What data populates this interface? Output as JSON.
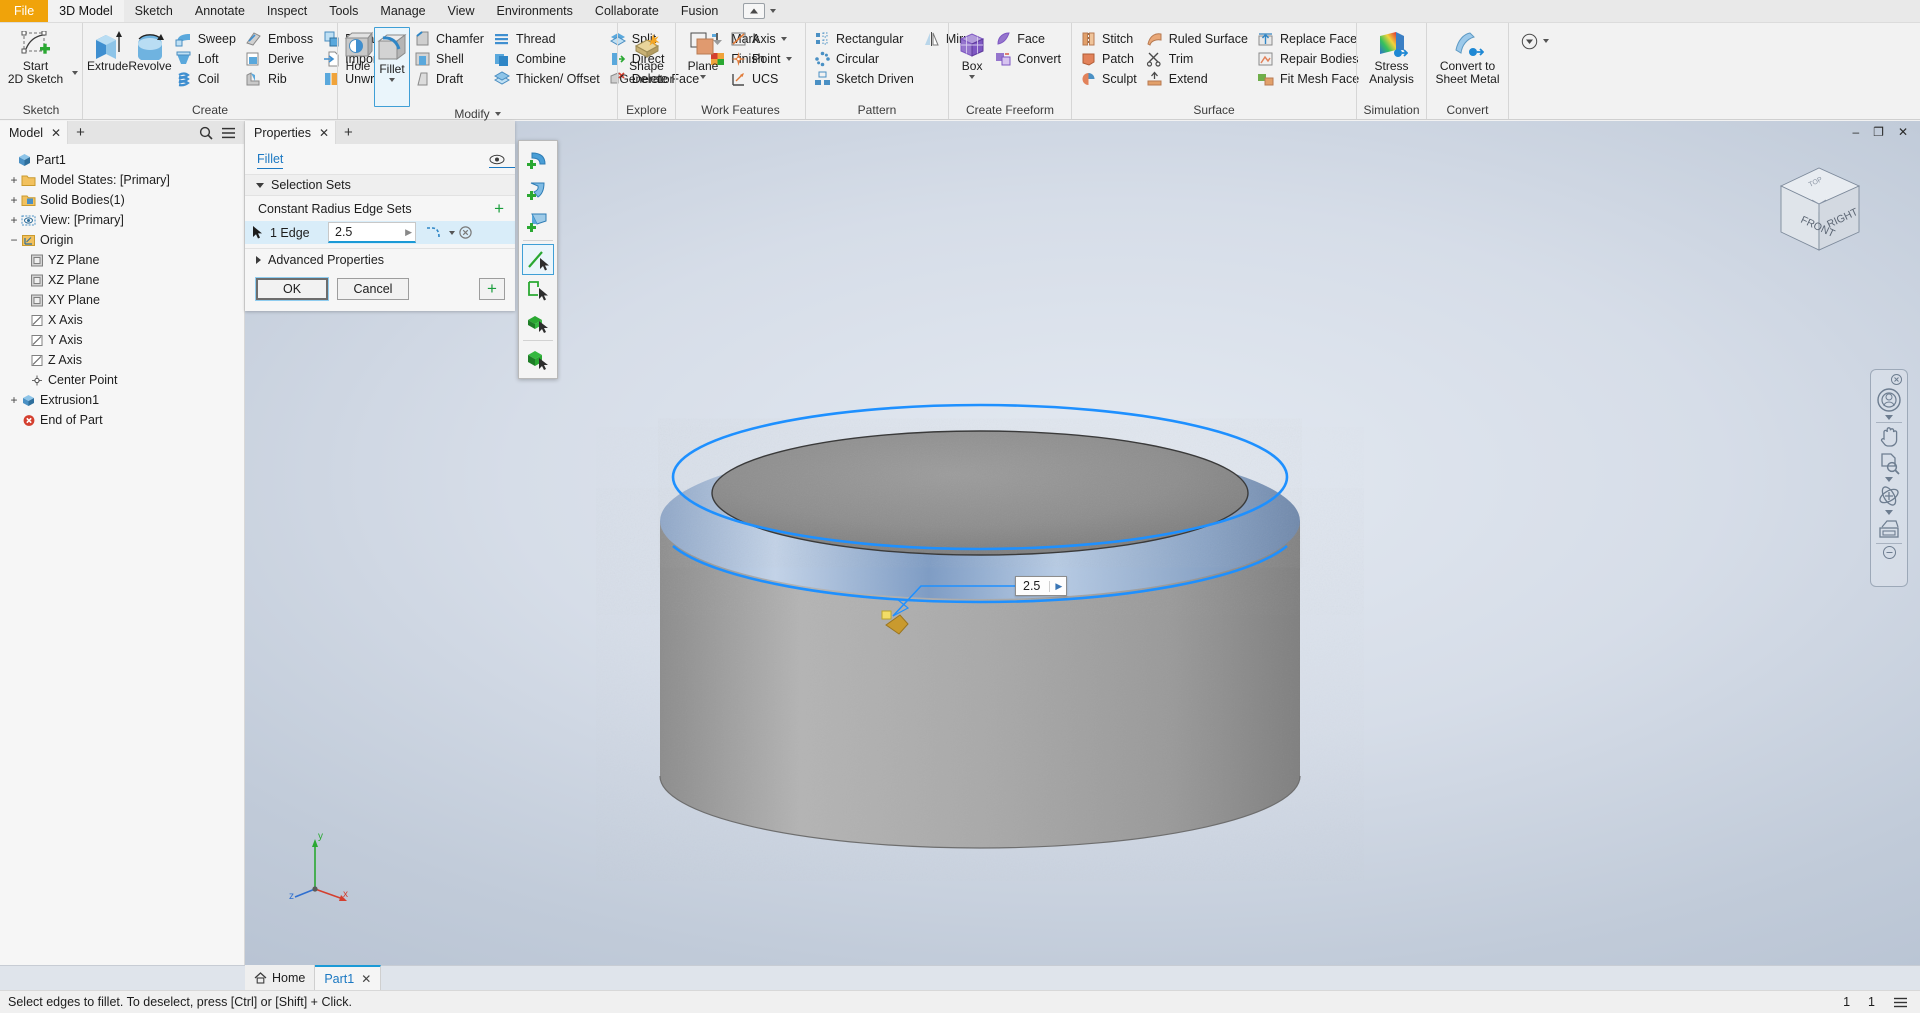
{
  "menu": {
    "items": [
      {
        "label": "File",
        "style": "file"
      },
      {
        "label": "3D Model",
        "style": "active"
      },
      {
        "label": "Sketch",
        "style": ""
      },
      {
        "label": "Annotate",
        "style": ""
      },
      {
        "label": "Inspect",
        "style": ""
      },
      {
        "label": "Tools",
        "style": ""
      },
      {
        "label": "Manage",
        "style": ""
      },
      {
        "label": "View",
        "style": ""
      },
      {
        "label": "Environments",
        "style": ""
      },
      {
        "label": "Collaborate",
        "style": ""
      },
      {
        "label": "Fusion",
        "style": ""
      }
    ],
    "quick_access_icon": "dropdown-button-icon"
  },
  "ribbon": {
    "panels": [
      {
        "title": "Sketch",
        "big": [
          {
            "label": "Start\n2D Sketch",
            "icon": "start-2d-sketch-icon",
            "dropdown": true
          }
        ],
        "cols": []
      },
      {
        "title": "Create",
        "big": [
          {
            "label": "Extrude",
            "icon": "extrude-icon"
          },
          {
            "label": "Revolve",
            "icon": "revolve-icon"
          }
        ],
        "cols": [
          [
            {
              "label": "Sweep",
              "icon": "sweep-icon"
            },
            {
              "label": "Loft",
              "icon": "loft-icon"
            },
            {
              "label": "Coil",
              "icon": "coil-icon"
            }
          ],
          [
            {
              "label": "Emboss",
              "icon": "emboss-icon"
            },
            {
              "label": "Derive",
              "icon": "derive-icon"
            },
            {
              "label": "Rib",
              "icon": "rib-icon"
            }
          ],
          [
            {
              "label": "Decal",
              "icon": "decal-icon"
            },
            {
              "label": "Import",
              "icon": "import-icon"
            },
            {
              "label": "Unwrap",
              "icon": "unwrap-icon"
            }
          ]
        ]
      },
      {
        "title": "Modify",
        "title_dropdown": true,
        "big": [
          {
            "label": "Hole",
            "icon": "hole-icon"
          },
          {
            "label": "Fillet",
            "icon": "fillet-icon",
            "dropdown": true,
            "selected": true
          }
        ],
        "cols": [
          [
            {
              "label": "Chamfer",
              "icon": "chamfer-icon"
            },
            {
              "label": "Shell",
              "icon": "shell-icon"
            },
            {
              "label": "Draft",
              "icon": "draft-icon"
            }
          ],
          [
            {
              "label": "Thread",
              "icon": "thread-icon"
            },
            {
              "label": "Combine",
              "icon": "combine-icon"
            },
            {
              "label": "Thicken/ Offset",
              "icon": "thicken-offset-icon"
            }
          ],
          [
            {
              "label": "Split",
              "icon": "split-icon"
            },
            {
              "label": "Direct",
              "icon": "direct-icon"
            },
            {
              "label": "Delete Face",
              "icon": "delete-face-icon"
            }
          ],
          [
            {
              "label": "Mark",
              "icon": "mark-icon"
            },
            {
              "label": "Finish",
              "icon": "finish-icon"
            }
          ]
        ]
      },
      {
        "title": "Explore",
        "big": [
          {
            "label": "Shape\nGenerator",
            "icon": "shape-generator-icon"
          }
        ],
        "cols": []
      },
      {
        "title": "Work Features",
        "big": [
          {
            "label": "Plane",
            "icon": "plane-icon",
            "dropdown": true
          }
        ],
        "cols": [
          [
            {
              "label": "Axis",
              "icon": "axis-icon",
              "dropdown": true
            },
            {
              "label": "Point",
              "icon": "point-icon",
              "dropdown": true
            },
            {
              "label": "UCS",
              "icon": "ucs-icon"
            }
          ]
        ]
      },
      {
        "title": "Pattern",
        "big": [],
        "cols": [
          [
            {
              "label": "Rectangular",
              "icon": "rectangular-pattern-icon"
            },
            {
              "label": "Circular",
              "icon": "circular-pattern-icon"
            },
            {
              "label": "Sketch Driven",
              "icon": "sketch-driven-pattern-icon"
            }
          ],
          [
            {
              "label": "Mirror",
              "icon": "mirror-icon"
            }
          ]
        ]
      },
      {
        "title": "Create Freeform",
        "big": [
          {
            "label": "Box",
            "icon": "box-icon",
            "dropdown": true
          }
        ],
        "cols": [
          [
            {
              "label": "Face",
              "icon": "face-icon"
            },
            {
              "label": "Convert",
              "icon": "convert-freeform-icon"
            }
          ]
        ]
      },
      {
        "title": "Surface",
        "big": [],
        "cols": [
          [
            {
              "label": "Stitch",
              "icon": "stitch-icon"
            },
            {
              "label": "Patch",
              "icon": "patch-icon"
            },
            {
              "label": "Sculpt",
              "icon": "sculpt-icon"
            }
          ],
          [
            {
              "label": "Ruled Surface",
              "icon": "ruled-surface-icon"
            },
            {
              "label": "Trim",
              "icon": "trim-icon"
            },
            {
              "label": "Extend",
              "icon": "extend-icon"
            }
          ],
          [
            {
              "label": "Replace Face",
              "icon": "replace-face-icon"
            },
            {
              "label": "Repair Bodies",
              "icon": "repair-bodies-icon"
            },
            {
              "label": "Fit Mesh Face",
              "icon": "fit-mesh-face-icon"
            }
          ]
        ]
      },
      {
        "title": "Simulation",
        "big": [
          {
            "label": "Stress\nAnalysis",
            "icon": "stress-analysis-icon"
          }
        ],
        "cols": []
      },
      {
        "title": "Convert",
        "big": [
          {
            "label": "Convert to\nSheet Metal",
            "icon": "convert-sheet-metal-icon"
          }
        ],
        "cols": []
      }
    ],
    "overflow_icon": "ribbon-overflow-icon"
  },
  "browser": {
    "tab_label": "Model",
    "close_icon": "close-icon",
    "add_icon": "add-tab-icon",
    "search_icon": "search-icon",
    "menu_icon": "hamburger-menu-icon",
    "nodes": [
      {
        "label": "Part1",
        "indent": 0,
        "expander": "",
        "icon": "part-icon"
      },
      {
        "label": "Model States: [Primary]",
        "indent": 1,
        "expander": "+",
        "icon": "folder-icon"
      },
      {
        "label": "Solid Bodies(1)",
        "indent": 1,
        "expander": "+",
        "icon": "solid-bodies-icon"
      },
      {
        "label": "View: [Primary]",
        "indent": 1,
        "expander": "+",
        "icon": "view-icon"
      },
      {
        "label": "Origin",
        "indent": 1,
        "expander": "-",
        "icon": "origin-icon"
      },
      {
        "label": "YZ Plane",
        "indent": 2,
        "expander": "",
        "icon": "plane-node-icon"
      },
      {
        "label": "XZ Plane",
        "indent": 2,
        "expander": "",
        "icon": "plane-node-icon"
      },
      {
        "label": "XY Plane",
        "indent": 2,
        "expander": "",
        "icon": "plane-node-icon"
      },
      {
        "label": "X Axis",
        "indent": 2,
        "expander": "",
        "icon": "axis-node-icon"
      },
      {
        "label": "Y Axis",
        "indent": 2,
        "expander": "",
        "icon": "axis-node-icon"
      },
      {
        "label": "Z Axis",
        "indent": 2,
        "expander": "",
        "icon": "axis-node-icon"
      },
      {
        "label": "Center Point",
        "indent": 2,
        "expander": "",
        "icon": "center-point-icon"
      },
      {
        "label": "Extrusion1",
        "indent": 1,
        "expander": "+",
        "icon": "extrusion-icon"
      },
      {
        "label": "End of Part",
        "indent": 1,
        "expander": "",
        "icon": "end-of-part-icon"
      }
    ]
  },
  "properties": {
    "tab_label": "Properties",
    "close_icon": "close-icon",
    "add_icon": "add-tab-icon",
    "command_name": "Fillet",
    "visibility_icon": "eye-icon",
    "section_selection_sets": "Selection Sets",
    "sub_label": "Constant Radius Edge Sets",
    "add_set_icon": "add-selection-set-icon",
    "edge_count_label": "1 Edge",
    "cursor_icon": "selection-arrow-icon",
    "radius_value": "2.5",
    "spinner_icon": "spinner-arrow-icon",
    "fillet_preview_icon": "fillet-radius-icon",
    "clear_icon": "clear-selection-icon",
    "section_advanced": "Advanced Properties",
    "ok_label": "OK",
    "cancel_label": "Cancel",
    "add_label": "+"
  },
  "mini_toolbar": {
    "buttons": [
      {
        "name": "add-constant-radius-fillet-icon"
      },
      {
        "name": "add-variable-radius-fillet-icon"
      },
      {
        "name": "add-setback-fillet-icon"
      },
      {
        "name": "select-edge-mode-icon",
        "selected": true
      },
      {
        "name": "select-loop-mode-icon"
      },
      {
        "name": "select-feature-mode-icon"
      },
      {
        "name": "select-solid-mode-icon"
      }
    ]
  },
  "viewport": {
    "dimension_callout": {
      "value": "2.5",
      "expand_icon": "callout-expand-icon"
    },
    "viewcube": {
      "face_front": "FRONT",
      "face_right": "RIGHT",
      "face_top": "TOP",
      "name": "view-cube"
    },
    "navbar": {
      "buttons": [
        {
          "name": "full-navigation-wheel-icon"
        },
        {
          "name": "pan-icon"
        },
        {
          "name": "zoom-icon"
        },
        {
          "name": "orbit-icon"
        },
        {
          "name": "look-at-icon"
        },
        {
          "name": "navbar-options-icon"
        }
      ],
      "close_icon": "navbar-close-icon"
    },
    "triad": {
      "x_label": "x",
      "y_label": "y",
      "z_label": "z"
    }
  },
  "window_controls": {
    "minimize": "–",
    "restore": "❐",
    "close": "✕"
  },
  "doc_tabs": {
    "home_label": "Home",
    "home_icon": "home-icon",
    "tabs": [
      {
        "label": "Part1",
        "active": true,
        "close_icon": "close-icon"
      }
    ]
  },
  "status_bar": {
    "message": "Select edges to fillet. To deselect, press [Ctrl] or [Shift] + Click.",
    "page_current": "1",
    "page_total": "1",
    "menu_icon": "status-menu-icon"
  },
  "colors": {
    "accent": "#1b9ad6",
    "file_tab": "#f0a30a",
    "link": "#1b78c2",
    "selection_blue": "#2196f3",
    "panel_bg": "#f6f6f6"
  }
}
